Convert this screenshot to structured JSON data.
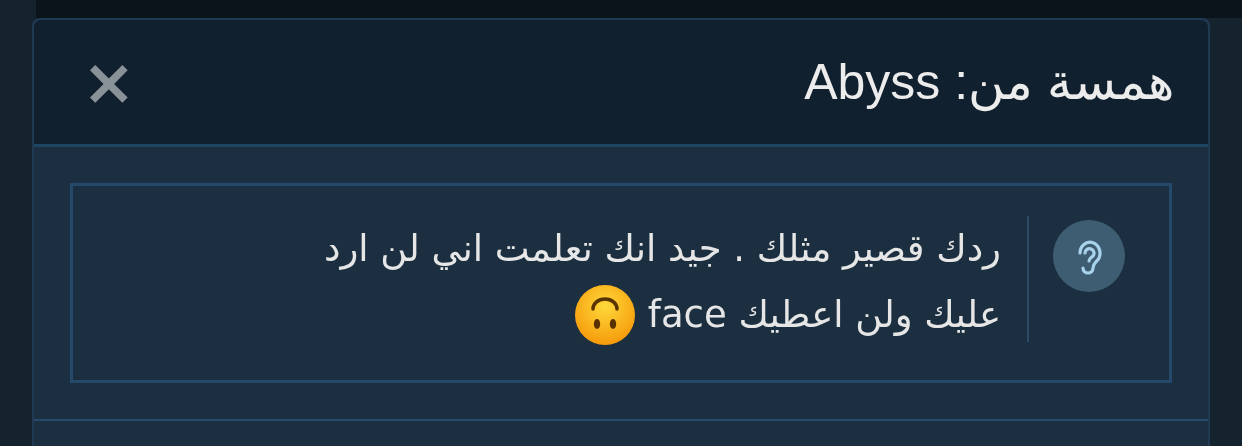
{
  "dialog": {
    "title": "همسة من: Abyss",
    "close_symbol": "×"
  },
  "message": {
    "lines": [
      "ردك قصير مثلك . جيد انك تعلمت اني لن ارد",
      "عليك ولن اعطيك face"
    ]
  }
}
